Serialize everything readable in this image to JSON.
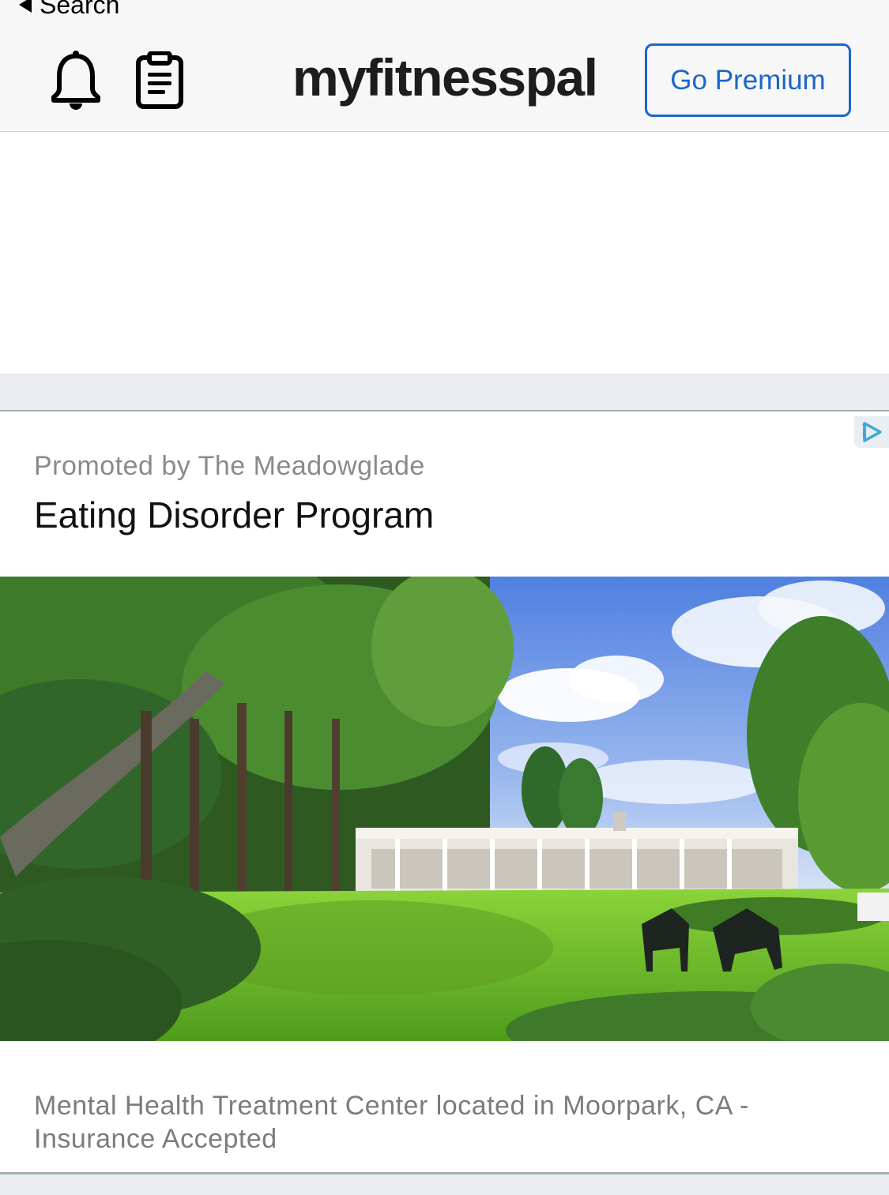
{
  "status_bar": {
    "back_label": "Search"
  },
  "header": {
    "logo_text": "myfitnesspal",
    "premium_button_label": "Go Premium",
    "icons": [
      "bell-icon",
      "clipboard-icon"
    ]
  },
  "promo": {
    "sponsor_line": "Promoted by The Meadowglade",
    "headline": "Eating Disorder Program",
    "description": "Mental Health Treatment Center located in Moorpark, CA - Insurance Accepted",
    "adchoices_icon": "adchoices-icon",
    "image_subject": "landscape"
  },
  "colors": {
    "accent": "#1b66c9",
    "header_bg": "#f7f7f7",
    "page_bg": "#ebecef",
    "muted_text": "#8a8a8e"
  }
}
